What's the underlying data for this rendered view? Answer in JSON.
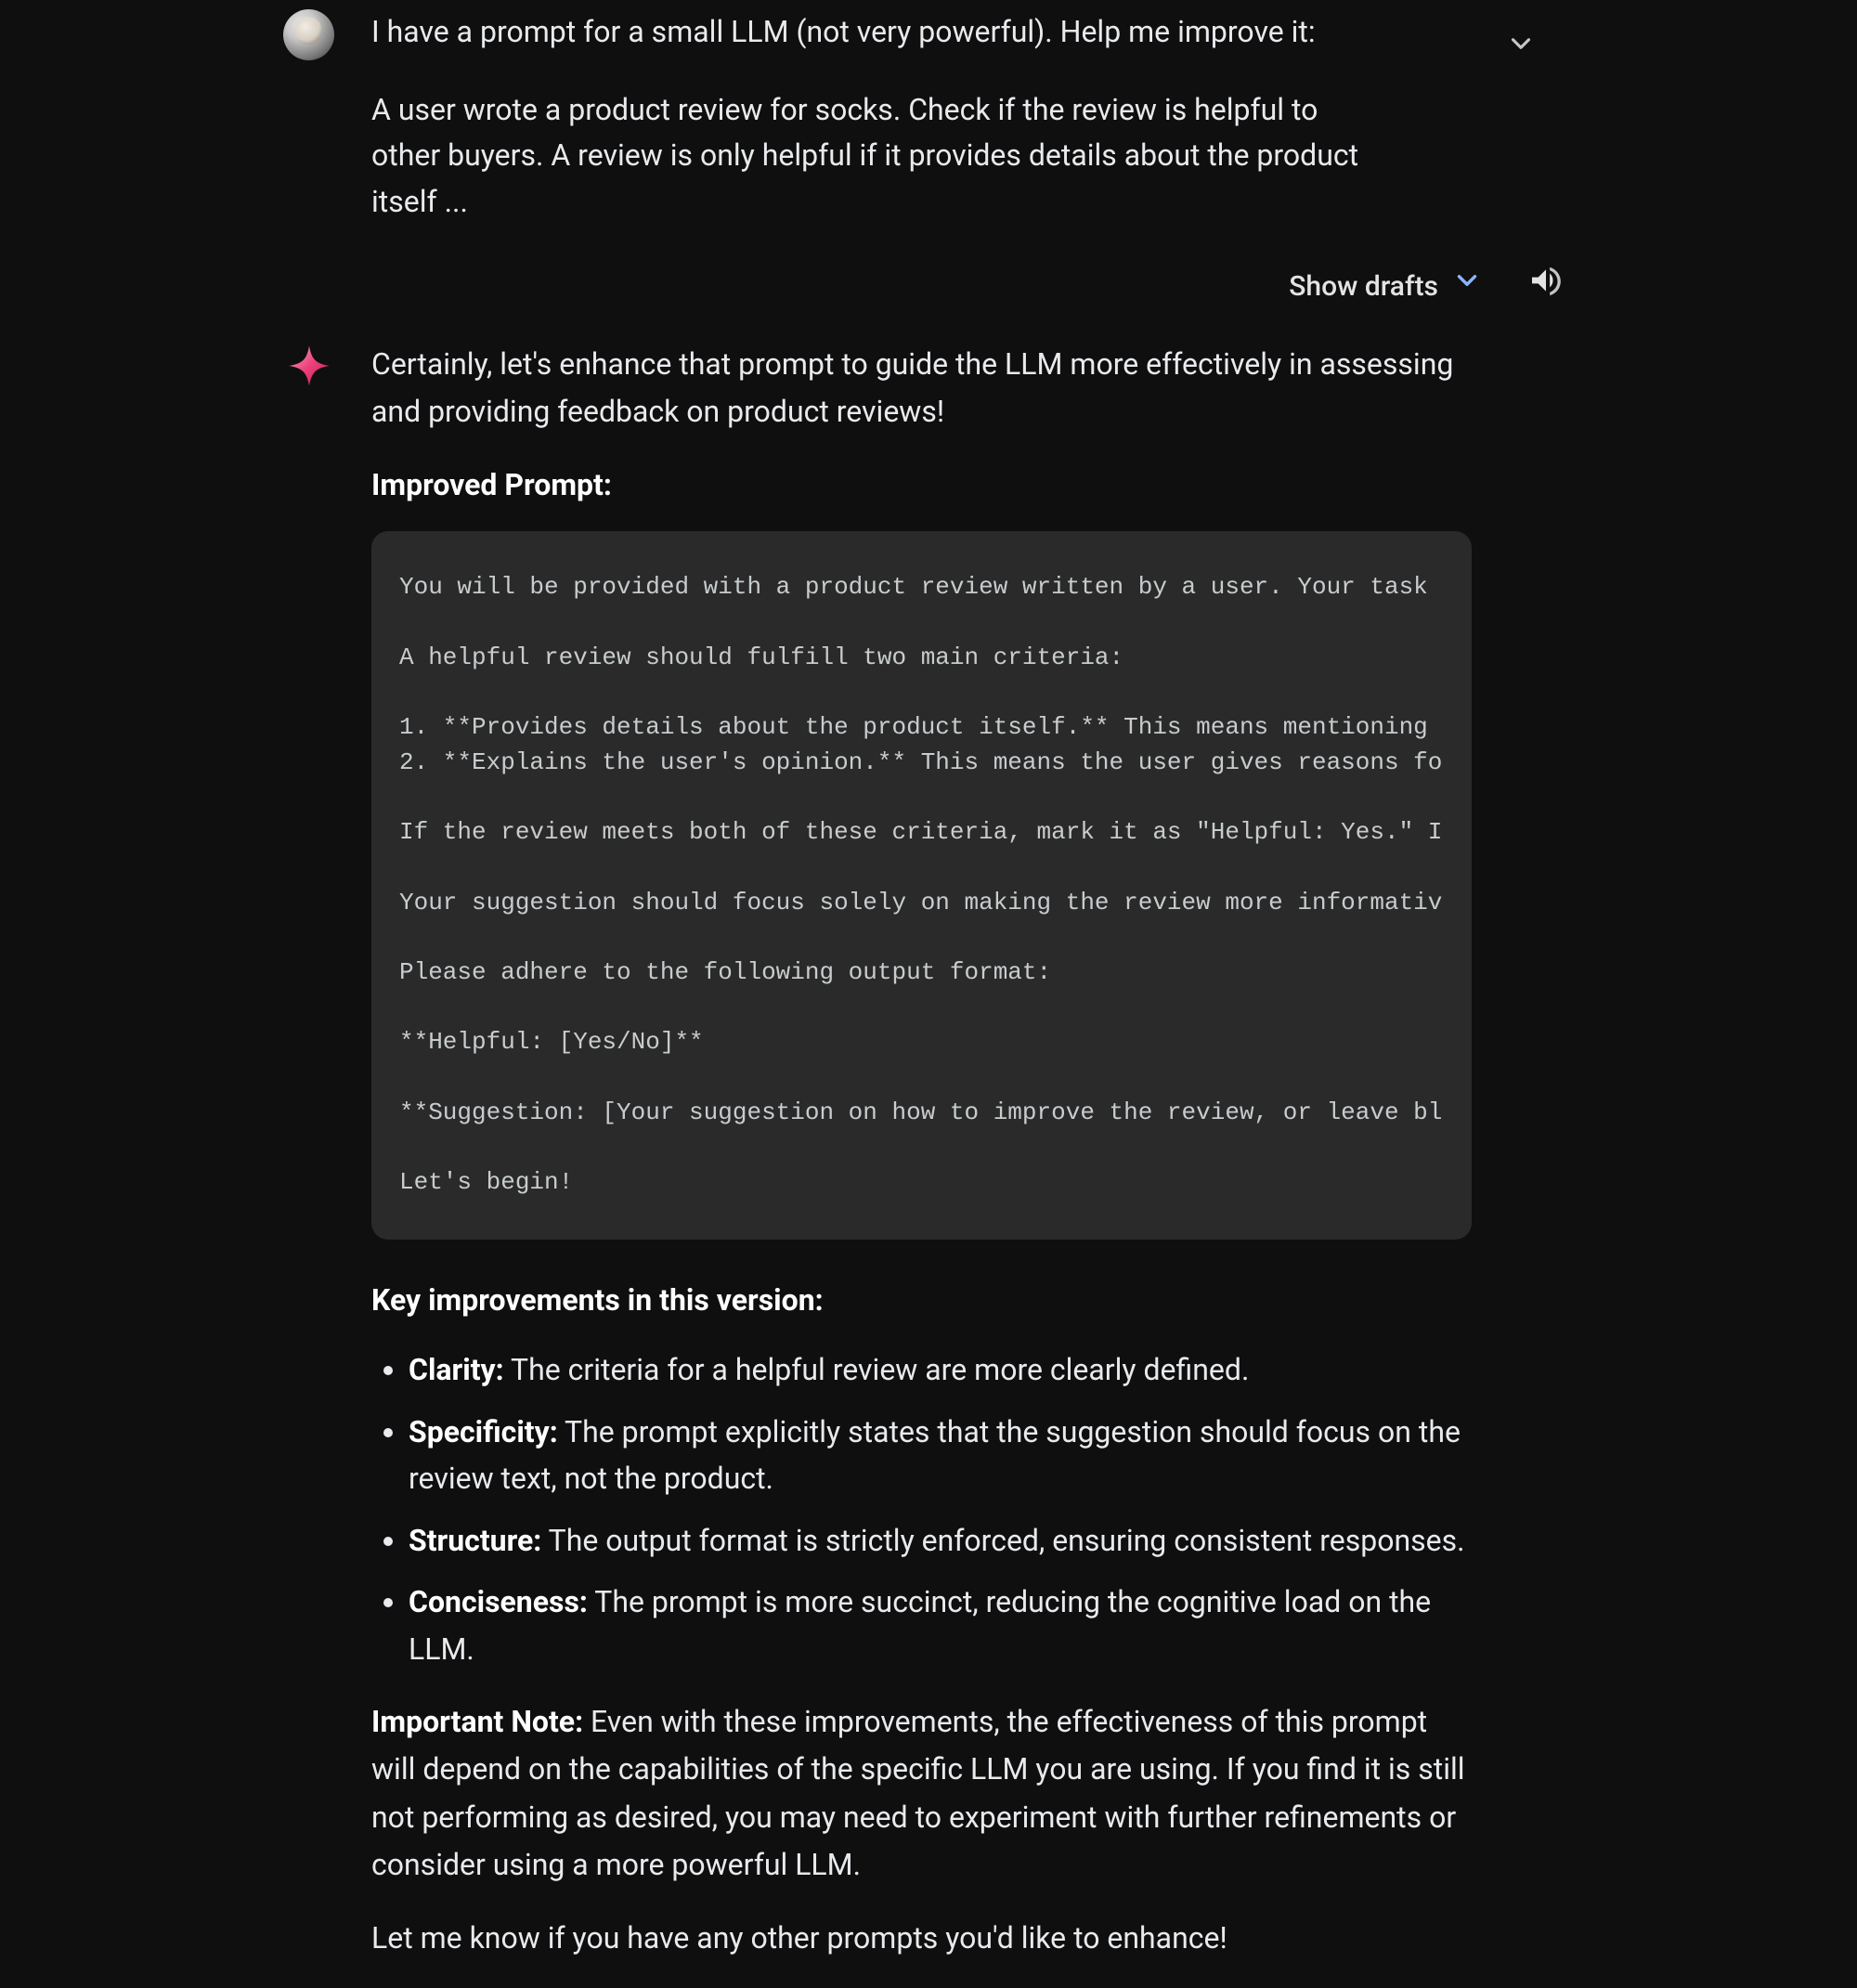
{
  "user": {
    "line1": "I have a prompt for a small LLM (not very powerful). Help me improve it:",
    "line2": "A user wrote a product review for socks. Check if the review is helpful to other buyers. A review is only helpful if it provides details about the product itself ..."
  },
  "toolbar": {
    "show_drafts": "Show drafts"
  },
  "ai": {
    "intro": "Certainly, let's enhance that prompt to guide the LLM more effectively in assessing and providing feedback on product reviews!",
    "improved_heading": "Improved Prompt:",
    "code": "You will be provided with a product review written by a user. Your task \n\nA helpful review should fulfill two main criteria:\n\n1. **Provides details about the product itself.** This means mentioning \n2. **Explains the user's opinion.** This means the user gives reasons fo\n\nIf the review meets both of these criteria, mark it as \"Helpful: Yes.\" I\n\nYour suggestion should focus solely on making the review more informativ\n\nPlease adhere to the following output format:\n\n**Helpful: [Yes/No]**\n\n**Suggestion: [Your suggestion on how to improve the review, or leave bl\n\nLet's begin!",
    "improvements_heading": "Key improvements in this version:",
    "improvements": [
      {
        "term": "Clarity:",
        "desc": " The criteria for a helpful review are more clearly defined."
      },
      {
        "term": "Specificity:",
        "desc": " The prompt explicitly states that the suggestion should focus on the review text, not the product."
      },
      {
        "term": "Structure:",
        "desc": " The output format is strictly enforced, ensuring consistent responses."
      },
      {
        "term": "Conciseness:",
        "desc": " The prompt is more succinct, reducing the cognitive load on the LLM."
      }
    ],
    "note_label": "Important Note:",
    "note_body": " Even with these improvements, the effectiveness of this prompt will depend on the capabilities of the specific LLM you are using. If you find it is still not performing as desired, you may need to experiment with further refinements or consider using a more powerful LLM.",
    "closing": "Let me know if you have any other prompts you'd like to enhance!"
  }
}
